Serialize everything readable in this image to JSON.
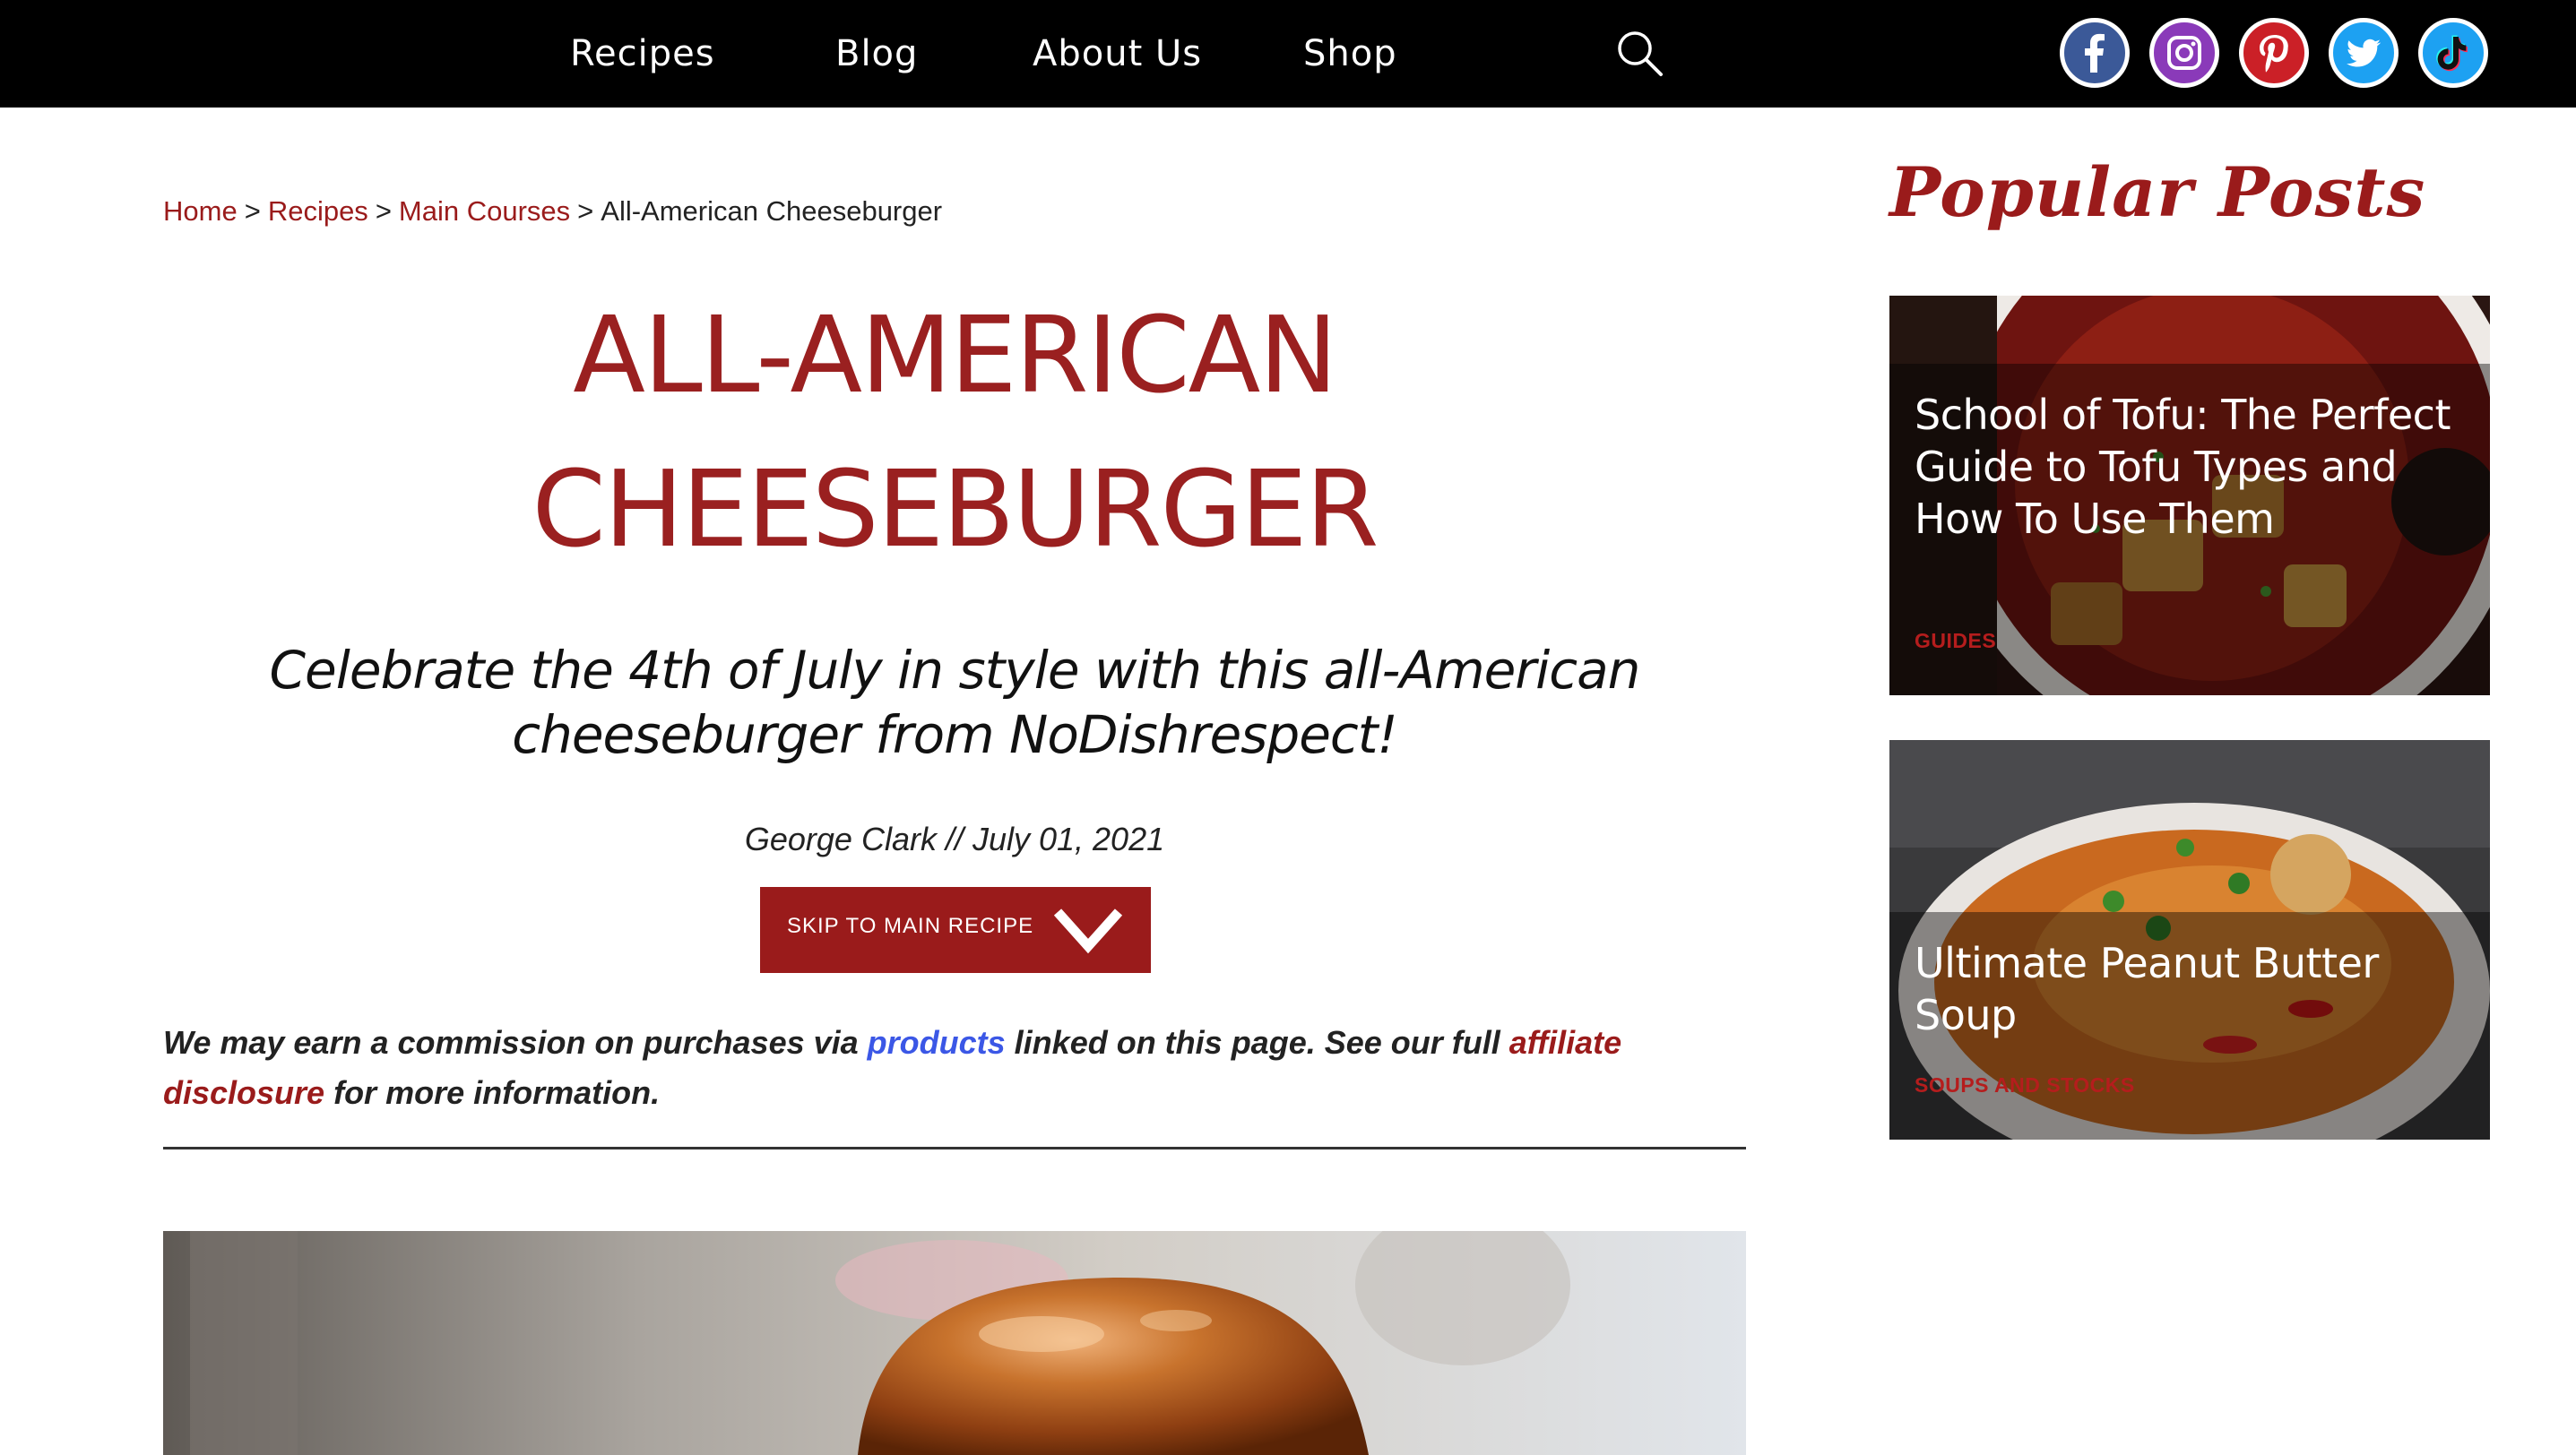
{
  "nav": {
    "items": [
      {
        "label": "Recipes"
      },
      {
        "label": "Blog"
      },
      {
        "label": "About Us"
      },
      {
        "label": "Shop"
      }
    ],
    "search_icon": "search-icon",
    "social": [
      {
        "name": "facebook-icon",
        "color": "#3b5998"
      },
      {
        "name": "instagram-icon",
        "color": "#8a3ab9"
      },
      {
        "name": "pinterest-icon",
        "color": "#cb2027"
      },
      {
        "name": "twitter-icon",
        "color": "#1da1f2"
      },
      {
        "name": "tiktok-icon",
        "color": "#1da1f2"
      }
    ]
  },
  "breadcrumb": {
    "items": [
      "Home",
      "Recipes",
      "Main Courses"
    ],
    "separator": ">",
    "current": "All-American Cheeseburger"
  },
  "article": {
    "title_line1": "ALL-AMERICAN",
    "title_line2": "CHEESEBURGER",
    "subtitle": "Celebrate the 4th of July in style with this all-American cheeseburger from NoDishrespect!",
    "byline": "George Clark // July 01, 2021",
    "skip_button": "Skip to main recipe",
    "disclosure": {
      "part1": "We may earn a commission on purchases via ",
      "link1": "products",
      "part2": " linked on this page. See our full ",
      "link2": "affiliate disclosure",
      "part3": " for more information."
    }
  },
  "sidebar": {
    "title": "Popular Posts",
    "posts": [
      {
        "title": "School of Tofu: The Perfect Guide to Tofu Types and How To Use Them",
        "category": "GUIDES"
      },
      {
        "title": "Ultimate Peanut Butter Soup",
        "category": "SOUPS AND STOCKS"
      }
    ]
  },
  "colors": {
    "brand_red": "#9a1b1b",
    "link_blue": "#3b57e6",
    "nav_bg": "#000000"
  }
}
